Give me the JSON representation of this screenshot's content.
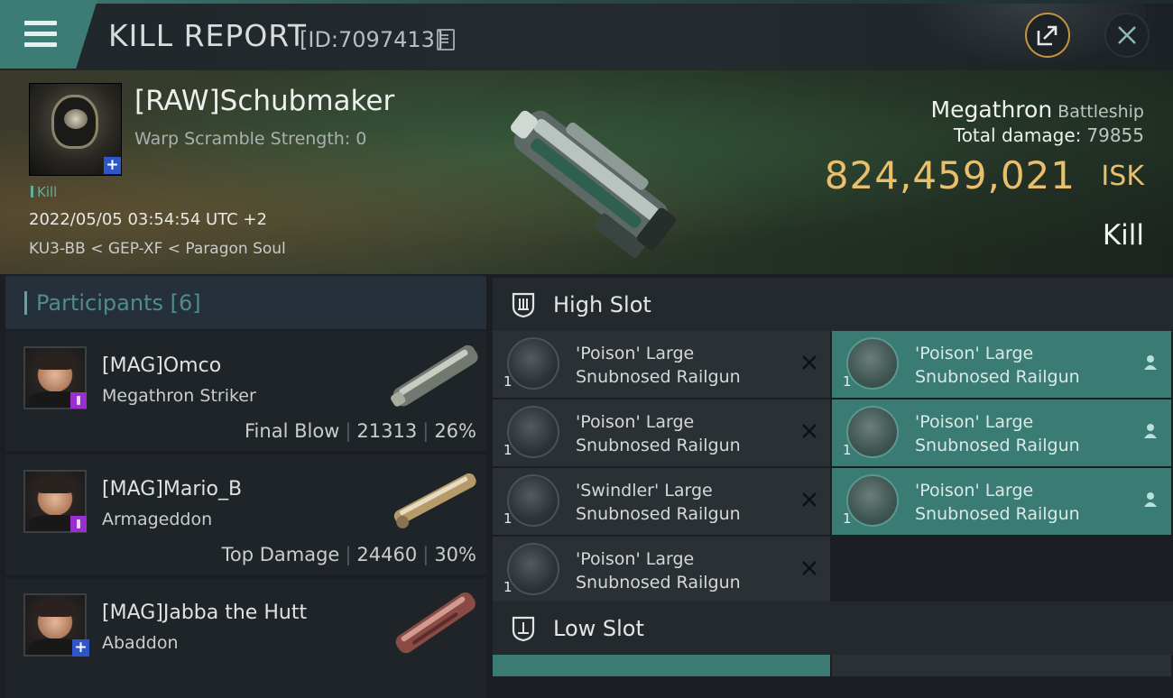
{
  "header": {
    "title": "KILL REPORT",
    "report_id": "[ID:7097413]",
    "share_icon": "share-icon",
    "close_icon": "close-icon",
    "accent": "#3d7b75"
  },
  "victim": {
    "name": "[RAW]Schubmaker",
    "warp_scramble": "Warp Scramble Strength: 0",
    "kill_tag": "Kill",
    "datetime": "2022/05/05 03:54:54 UTC +2",
    "location": "KU3-BB < GEP-XF < Paragon Soul",
    "ship": "Megathron",
    "ship_class": "Battleship",
    "damage_label": "Total damage:",
    "damage_value": "79855",
    "isk_value": "824,459,021",
    "isk_unit": "ISK",
    "result": "Kill",
    "isk_color": "#eabf6c"
  },
  "participants": {
    "title": "Participants",
    "count": "[6]",
    "items": [
      {
        "name": "[MAG]Omco",
        "ship": "Megathron Striker",
        "tag": "Final Blow",
        "damage": "21313",
        "percent": "26%"
      },
      {
        "name": "[MAG]Mario_B",
        "ship": "Armageddon",
        "tag": "Top Damage",
        "damage": "24460",
        "percent": "30%"
      },
      {
        "name": "[MAG]Jabba the Hutt",
        "ship": "Abaddon"
      }
    ]
  },
  "slots": {
    "high_title": "High Slot",
    "low_title": "Low Slot",
    "high": [
      {
        "qty": "1",
        "line1": "'Poison' Large",
        "line2": "Snubnosed Railgun",
        "status": "destroyed"
      },
      {
        "qty": "1",
        "line1": "'Poison' Large",
        "line2": "Snubnosed Railgun",
        "status": "dropped"
      },
      {
        "qty": "1",
        "line1": "'Poison' Large",
        "line2": "Snubnosed Railgun",
        "status": "destroyed"
      },
      {
        "qty": "1",
        "line1": "'Poison' Large",
        "line2": "Snubnosed Railgun",
        "status": "dropped"
      },
      {
        "qty": "1",
        "line1": "'Swindler' Large",
        "line2": "Snubnosed Railgun",
        "status": "destroyed"
      },
      {
        "qty": "1",
        "line1": "'Poison' Large",
        "line2": "Snubnosed Railgun",
        "status": "dropped"
      },
      {
        "qty": "1",
        "line1": "'Poison' Large",
        "line2": "Snubnosed Railgun",
        "status": "destroyed"
      }
    ]
  }
}
